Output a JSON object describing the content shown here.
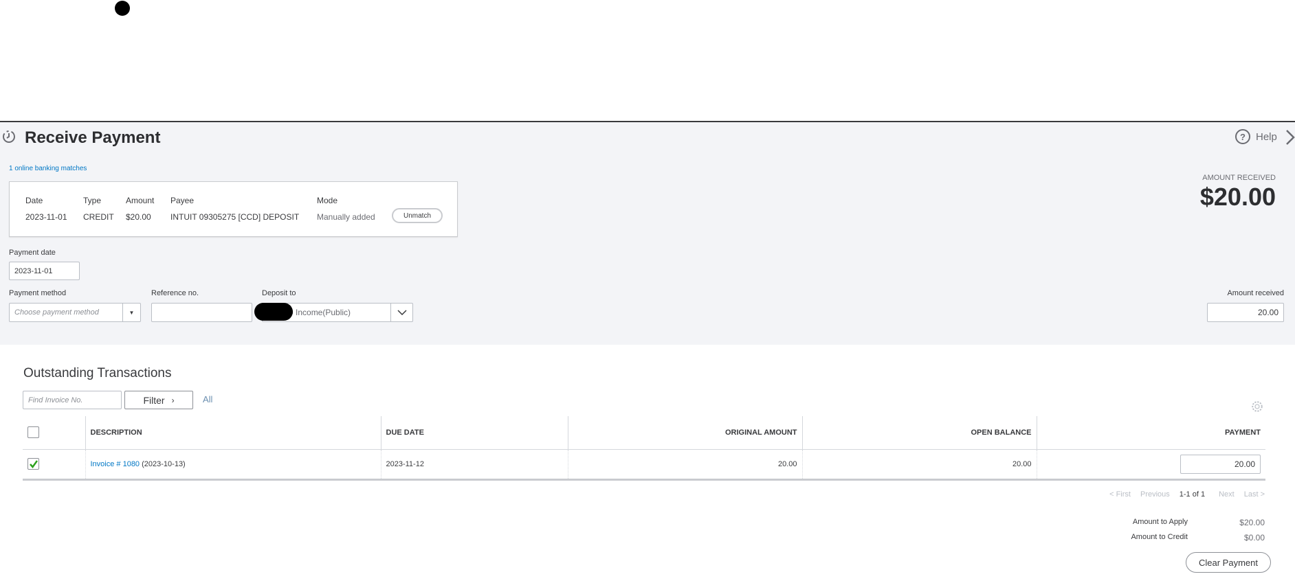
{
  "header": {
    "title": "Receive Payment",
    "help_label": "Help"
  },
  "banking": {
    "link": "1 online banking matches",
    "columns": [
      "Date",
      "Type",
      "Amount",
      "Payee",
      "Mode"
    ],
    "row": [
      "2023-11-01",
      "CREDIT",
      "$20.00",
      "INTUIT 09305275 [CCD] DEPOSIT",
      "Manually added"
    ],
    "unmatch_label": "Unmatch"
  },
  "amount_received": {
    "label": "AMOUNT RECEIVED",
    "value": "$20.00"
  },
  "form": {
    "payment_date_label": "Payment date",
    "payment_date": "2023-11-01",
    "payment_method_label": "Payment method",
    "payment_method_placeholder": "Choose payment method",
    "reference_label": "Reference no.",
    "reference_value": "",
    "deposit_label": "Deposit to",
    "deposit_value": "9 Income(Public)",
    "amount_label": "Amount received",
    "amount_value": "20.00"
  },
  "outstanding": {
    "title": "Outstanding Transactions",
    "find_placeholder": "Find Invoice No.",
    "filter_label": "Filter",
    "all_label": "All",
    "columns": [
      "DESCRIPTION",
      "DUE DATE",
      "ORIGINAL AMOUNT",
      "OPEN BALANCE",
      "PAYMENT"
    ],
    "rows": [
      {
        "checked": true,
        "invoice_link": "Invoice # 1080",
        "invoice_date": "(2023-10-13)",
        "due_date": "2023-11-12",
        "original": "20.00",
        "open_balance": "20.00",
        "payment": "20.00"
      }
    ],
    "pager": {
      "first": "< First",
      "previous": "Previous",
      "range": "1-1 of 1",
      "next": "Next",
      "last": "Last >"
    },
    "apply_label": "Amount to Apply",
    "apply_value": "$20.00",
    "credit_label": "Amount to Credit",
    "credit_value": "$0.00",
    "clear_label": "Clear Payment"
  }
}
